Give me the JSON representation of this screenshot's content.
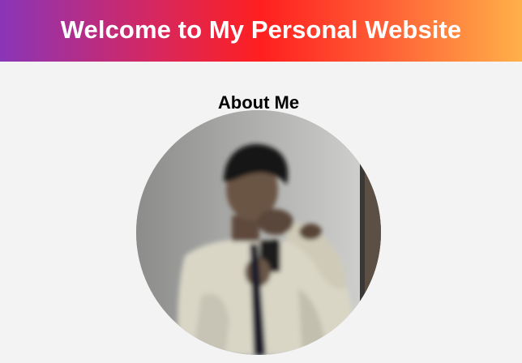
{
  "header": {
    "title": "Welcome to My Personal Website"
  },
  "about": {
    "heading": "About Me",
    "photo_icon": "profile-photo"
  },
  "colors": {
    "page_background": "#f3f3f3",
    "header_gradient_start": "#8a35b8",
    "header_gradient_mid": "#ff1f1f",
    "header_gradient_end": "#ffb04a",
    "header_text": "#ffffff"
  }
}
